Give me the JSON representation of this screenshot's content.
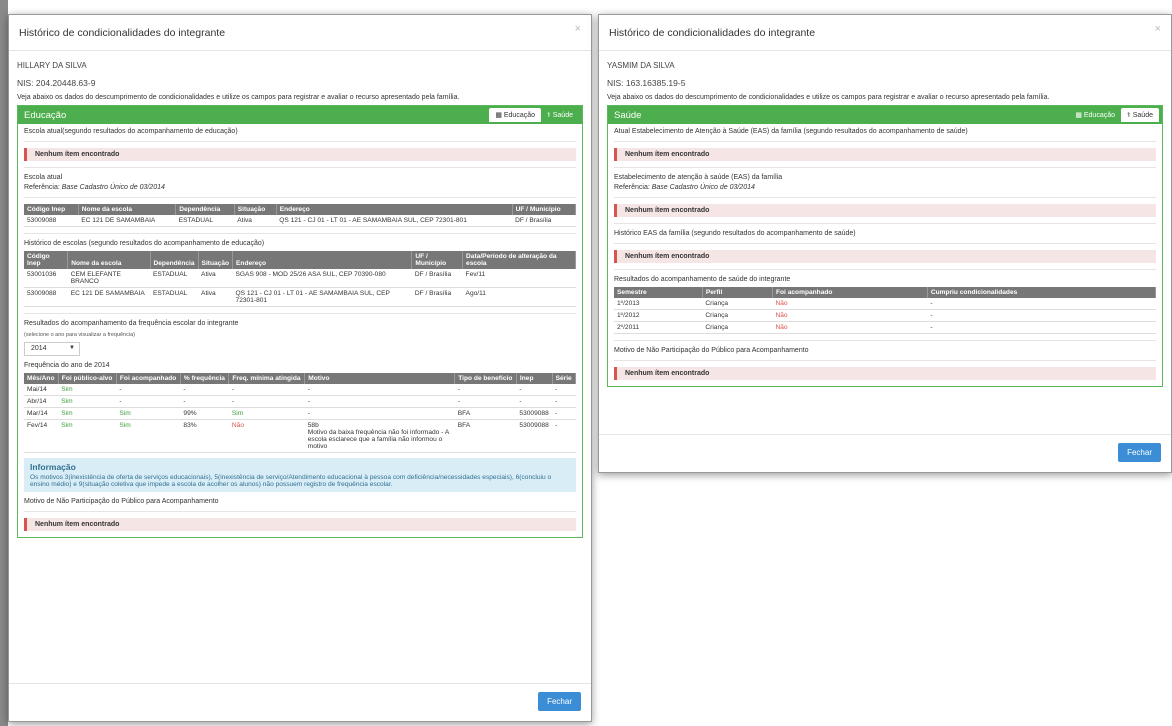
{
  "left": {
    "title": "Histórico de condicionalidades do integrante",
    "close": "×",
    "person": "HILLARY DA SILVA",
    "nis": "NIS: 204.20448.63-9",
    "intro": "Veja abaixo os dados do descumprimento de condicionalidades e utilize os campos para registrar e avaliar o recurso apresentado pela família.",
    "panel_title": "Educação",
    "tab_edu": "Educação",
    "tab_sau": "Saúde",
    "s1": "Escola atual(segundo resultados do acompanhamento de educação)",
    "none": "Nenhum ítem encontrado",
    "s2": "Escola atual",
    "ref_label": "Referência: ",
    "ref_value": "Base Cadastro Único de 03/2014",
    "t1_headers": [
      "Código Inep",
      "Nome da escola",
      "Dependência",
      "Situação",
      "Endereço",
      "UF / Município"
    ],
    "t1_rows": [
      [
        "53009088",
        "EC 121 DE SAMAMBAIA",
        "ESTADUAL",
        "Ativa",
        "QS 121 - CJ 01 - LT 01 - AE SAMAMBAIA SUL, CEP 72301-801",
        "DF / Brasília"
      ]
    ],
    "s3": "Histórico de escolas (segundo resultados do acompanhamento de educação)",
    "t2_headers": [
      "Código Inep",
      "Nome da escola",
      "Dependência",
      "Situação",
      "Endereço",
      "UF / Município",
      "Data/Período de alteração da escola"
    ],
    "t2_rows": [
      [
        "53001036",
        "CEM ELEFANTE BRANCO",
        "ESTADUAL",
        "Ativa",
        "SGAS 908 - MOD 25/26 ASA SUL, CEP 70390-080",
        "DF / Brasília",
        "Fev/11"
      ],
      [
        "53009088",
        "EC 121 DE SAMAMBAIA",
        "ESTADUAL",
        "Ativa",
        "QS 121 - CJ 01 - LT 01 - AE SAMAMBAIA SUL, CEP 72301-801",
        "DF / Brasília",
        "Ago/11"
      ]
    ],
    "s4": "Resultados do acompanhamento da frequência escolar do integrante",
    "hint": "(selecione o ano para visualizar a frequência)",
    "year": "2014",
    "s5": "Frequência do ano de 2014",
    "t3_headers": [
      "Mês/Ano",
      "Foi público-alvo",
      "Foi acompanhado",
      "% frequência",
      "Freq. mínima atingida",
      "Motivo",
      "Tipo de benefício",
      "Inep",
      "Série"
    ],
    "t3_rows": [
      [
        "Mai/14",
        "Sim",
        "-",
        "-",
        "-",
        "-",
        "-",
        "-",
        "-"
      ],
      [
        "Abr/14",
        "Sim",
        "-",
        "-",
        "-",
        "-",
        "-",
        "-",
        "-"
      ],
      [
        "Mar/14",
        "Sim",
        "Sim",
        "99%",
        "Sim",
        "-",
        "BFA",
        "53009088",
        "-"
      ],
      [
        "Fev/14",
        "Sim",
        "Sim",
        "83%",
        "Não",
        "58b\nMotivo da baixa frequência não foi informado - A escola esclarece que a família não informou o motivo",
        "BFA",
        "53009088",
        "-"
      ]
    ],
    "info_title": "Informação",
    "info_text": "Os motivos 3(inexistência de oferta de serviços educacionais), 5(inexistência de serviço/Atendimento educacional à pessoa com deficiência/necessidades especiais), 6(concluiu o ensino médio) e 9(situação coletiva que impede a escola de acolher os alunos) não possuem registro de frequência escolar.",
    "s6": "Motivo de Não Participação do Público para Acompanhamento",
    "btn": "Fechar"
  },
  "right": {
    "title": "Histórico de condicionalidades do integrante",
    "close": "×",
    "person": "YASMIM DA SILVA",
    "nis": "NIS: 163.16385.19-5",
    "intro": "Veja abaixo os dados do descumprimento de condicionalidades e utilize os campos para registrar e avaliar o recurso apresentado pela família.",
    "panel_title": "Saúde",
    "tab_edu": "Educação",
    "tab_sau": "Saúde",
    "s1": "Atual Estabelecimento de Atenção à Saúde (EAS) da família (segundo resultados do acompanhamento de saúde)",
    "none": "Nenhum ítem encontrado",
    "s2": "Estabelecimento de atenção à saúde (EAS) da família",
    "ref_label": "Referência: ",
    "ref_value": "Base Cadastro Único de 03/2014",
    "s3": "Histórico EAS da família (segundo resultados do acompanhamento de saúde)",
    "s4": "Resultados do acompanhamento de saúde do integrante",
    "t_headers": [
      "Semestre",
      "Perfil",
      "Foi acompanhado",
      "Cumpriu condicionalidades"
    ],
    "t_rows": [
      [
        "1º/2013",
        "Criança",
        "Não",
        "-"
      ],
      [
        "1º/2012",
        "Criança",
        "Não",
        "-"
      ],
      [
        "2º/2011",
        "Criança",
        "Não",
        "-"
      ]
    ],
    "s5": "Motivo de Não Participação do Público para Acompanhamento",
    "btn": "Fechar"
  }
}
